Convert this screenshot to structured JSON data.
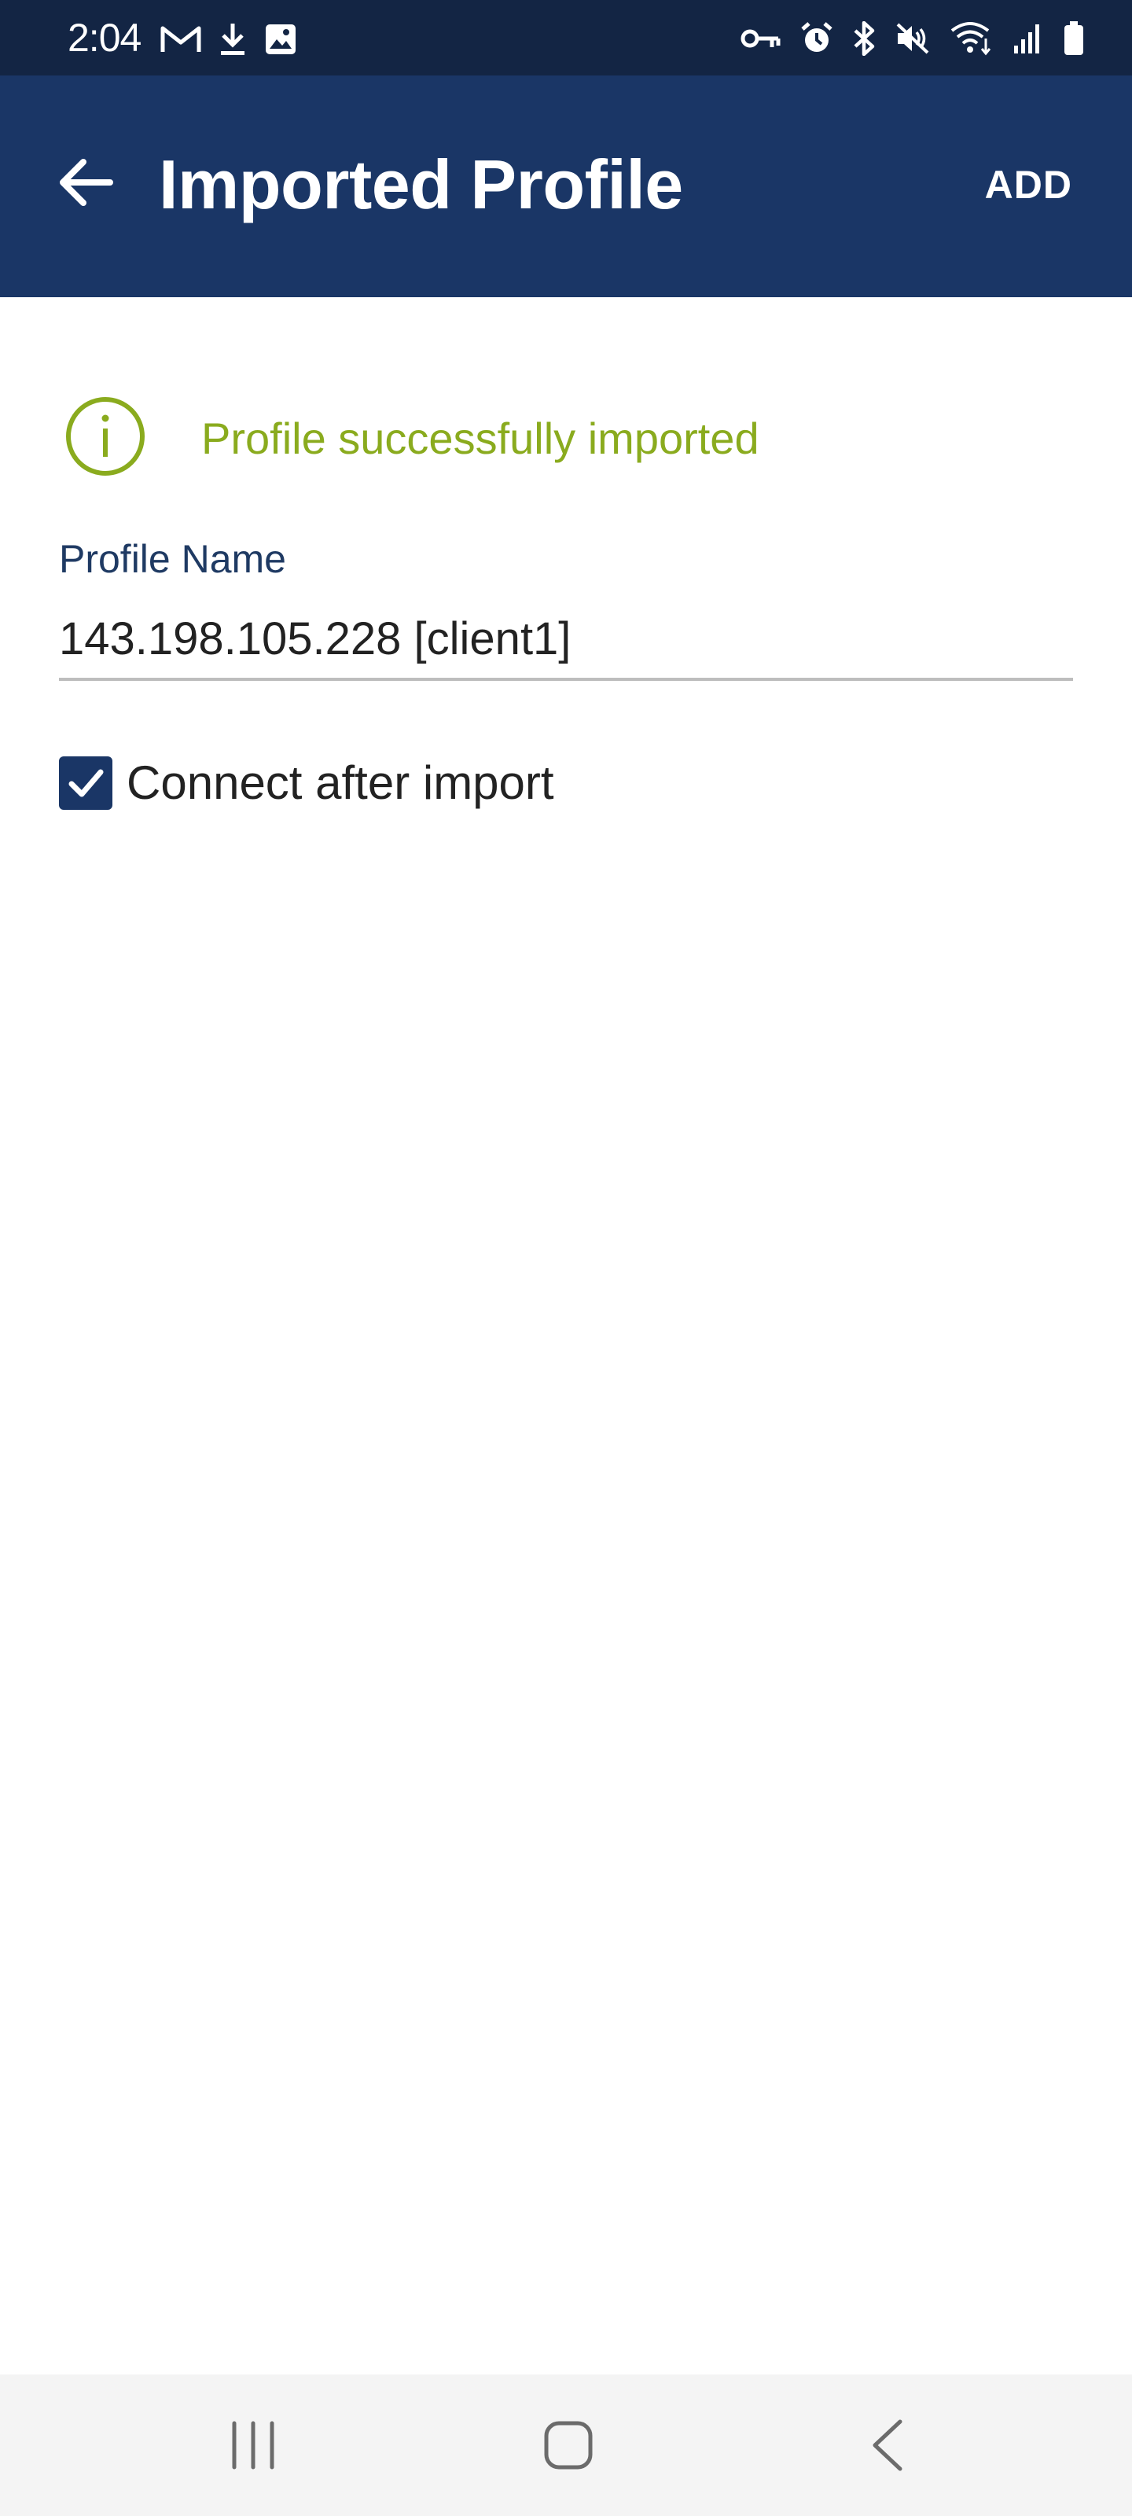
{
  "status_bar": {
    "time": "2:04",
    "left_icons": [
      "gmail-icon",
      "download-icon",
      "image-icon"
    ],
    "right_icons": [
      "vpn-key-icon",
      "alarm-icon",
      "bluetooth-icon",
      "mute-icon",
      "wifi-icon",
      "signal-icon",
      "battery-icon"
    ]
  },
  "app_bar": {
    "title": "Imported Profile",
    "add_label": "ADD",
    "color": "#1a3666"
  },
  "banner": {
    "message": "Profile successfully imported",
    "icon": "info-icon",
    "color": "#8aab1e"
  },
  "form": {
    "profile_name_label": "Profile Name",
    "profile_name_value": "143.198.105.228 [client1]",
    "connect_after_import_label": "Connect after import",
    "connect_after_import_checked": true
  },
  "nav_bar": {
    "buttons": [
      "recents-icon",
      "home-icon",
      "back-icon"
    ]
  }
}
